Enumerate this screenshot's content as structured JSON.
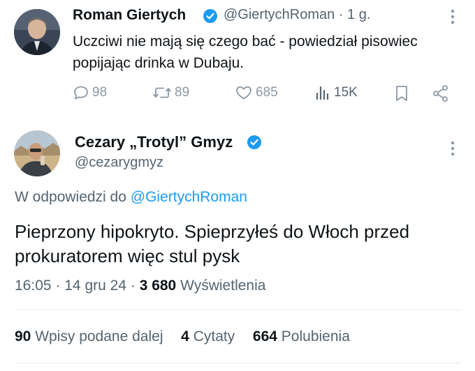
{
  "tweet1": {
    "author_name": "Roman Giertych",
    "handle": "@GiertychRoman",
    "separator": "·",
    "age": "1 g.",
    "text_line1": "Uczciwi nie mają się czego bać - powiedział pisowiec",
    "text_line2": "popijając drinka w Dubaju.",
    "replies": "98",
    "reposts": "89",
    "likes": "685",
    "views": "15K",
    "icons": [
      "verified-badge-icon",
      "more-icon",
      "reply-icon",
      "repost-icon",
      "like-icon",
      "views-icon",
      "bookmark-icon",
      "share-icon"
    ]
  },
  "tweet2": {
    "author_name": "Cezary „Trotyl” Gmyz",
    "handle": "@cezarygmyz",
    "reply_prefix": "W odpowiedzi do",
    "reply_to": "@GiertychRoman",
    "text_line1": "Pieprzony hipokryto. Spieprzyłeś do Włoch przed",
    "text_line2": "prokuratorem więc stul pysk",
    "time": "16:05",
    "date": "14 gru 24",
    "dot": "·",
    "views_count": "3 680",
    "views_label": "Wyświetlenia",
    "reposts_count": "90",
    "reposts_label": "Wpisy podane dalej",
    "quotes_count": "4",
    "quotes_label": "Cytaty",
    "likes_count": "664",
    "likes_label": "Polubienia"
  },
  "colors": {
    "accent": "#1d9bf0",
    "text": "#0f1419",
    "muted": "#536471",
    "icon": "#8b98a5"
  }
}
